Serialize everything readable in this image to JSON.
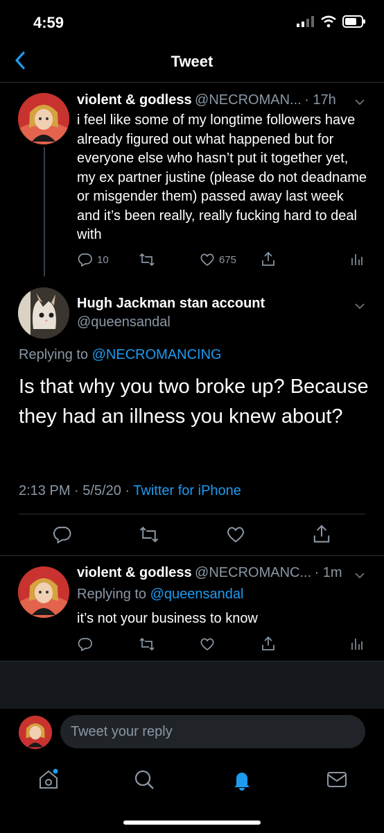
{
  "status": {
    "time": "4:59"
  },
  "header": {
    "title": "Tweet"
  },
  "tweet1": {
    "name": "violent & godless",
    "handle": "@NECROMAN...",
    "time": "· 17h",
    "text": "i feel like some of my longtime followers have already figured out what happened but for everyone else who hasn’t put it together yet, my ex partner justine (please do not deadname or misgender them) passed away last week and it’s been really, really fucking hard to deal with",
    "replies": "10",
    "likes": "675"
  },
  "focused": {
    "name": "Hugh Jackman stan account",
    "handle": "@queensandal",
    "replying_prefix": "Replying to",
    "replying_handle": "@NECROMANCING",
    "text": "Is that why you two broke up? Because they had an illness you knew about?",
    "timestamp": "2:13 PM · 5/5/20 ·",
    "source": "Twitter for iPhone"
  },
  "tweet2": {
    "name": "violent & godless",
    "handle": "@NECROMANC...",
    "time": "· 1m",
    "replying_prefix": "Replying to",
    "replying_handle": "@queensandal",
    "text": "it’s not your business to know"
  },
  "reply_box": {
    "placeholder": "Tweet your reply"
  },
  "colors": {
    "accent": "#1d9bf0",
    "muted": "#8b98a5",
    "background": "#000000"
  },
  "icons": [
    "back-chevron-icon",
    "reply-icon",
    "retweet-icon",
    "like-icon",
    "share-icon",
    "analytics-icon",
    "home-icon",
    "search-icon",
    "notifications-icon",
    "messages-icon"
  ]
}
